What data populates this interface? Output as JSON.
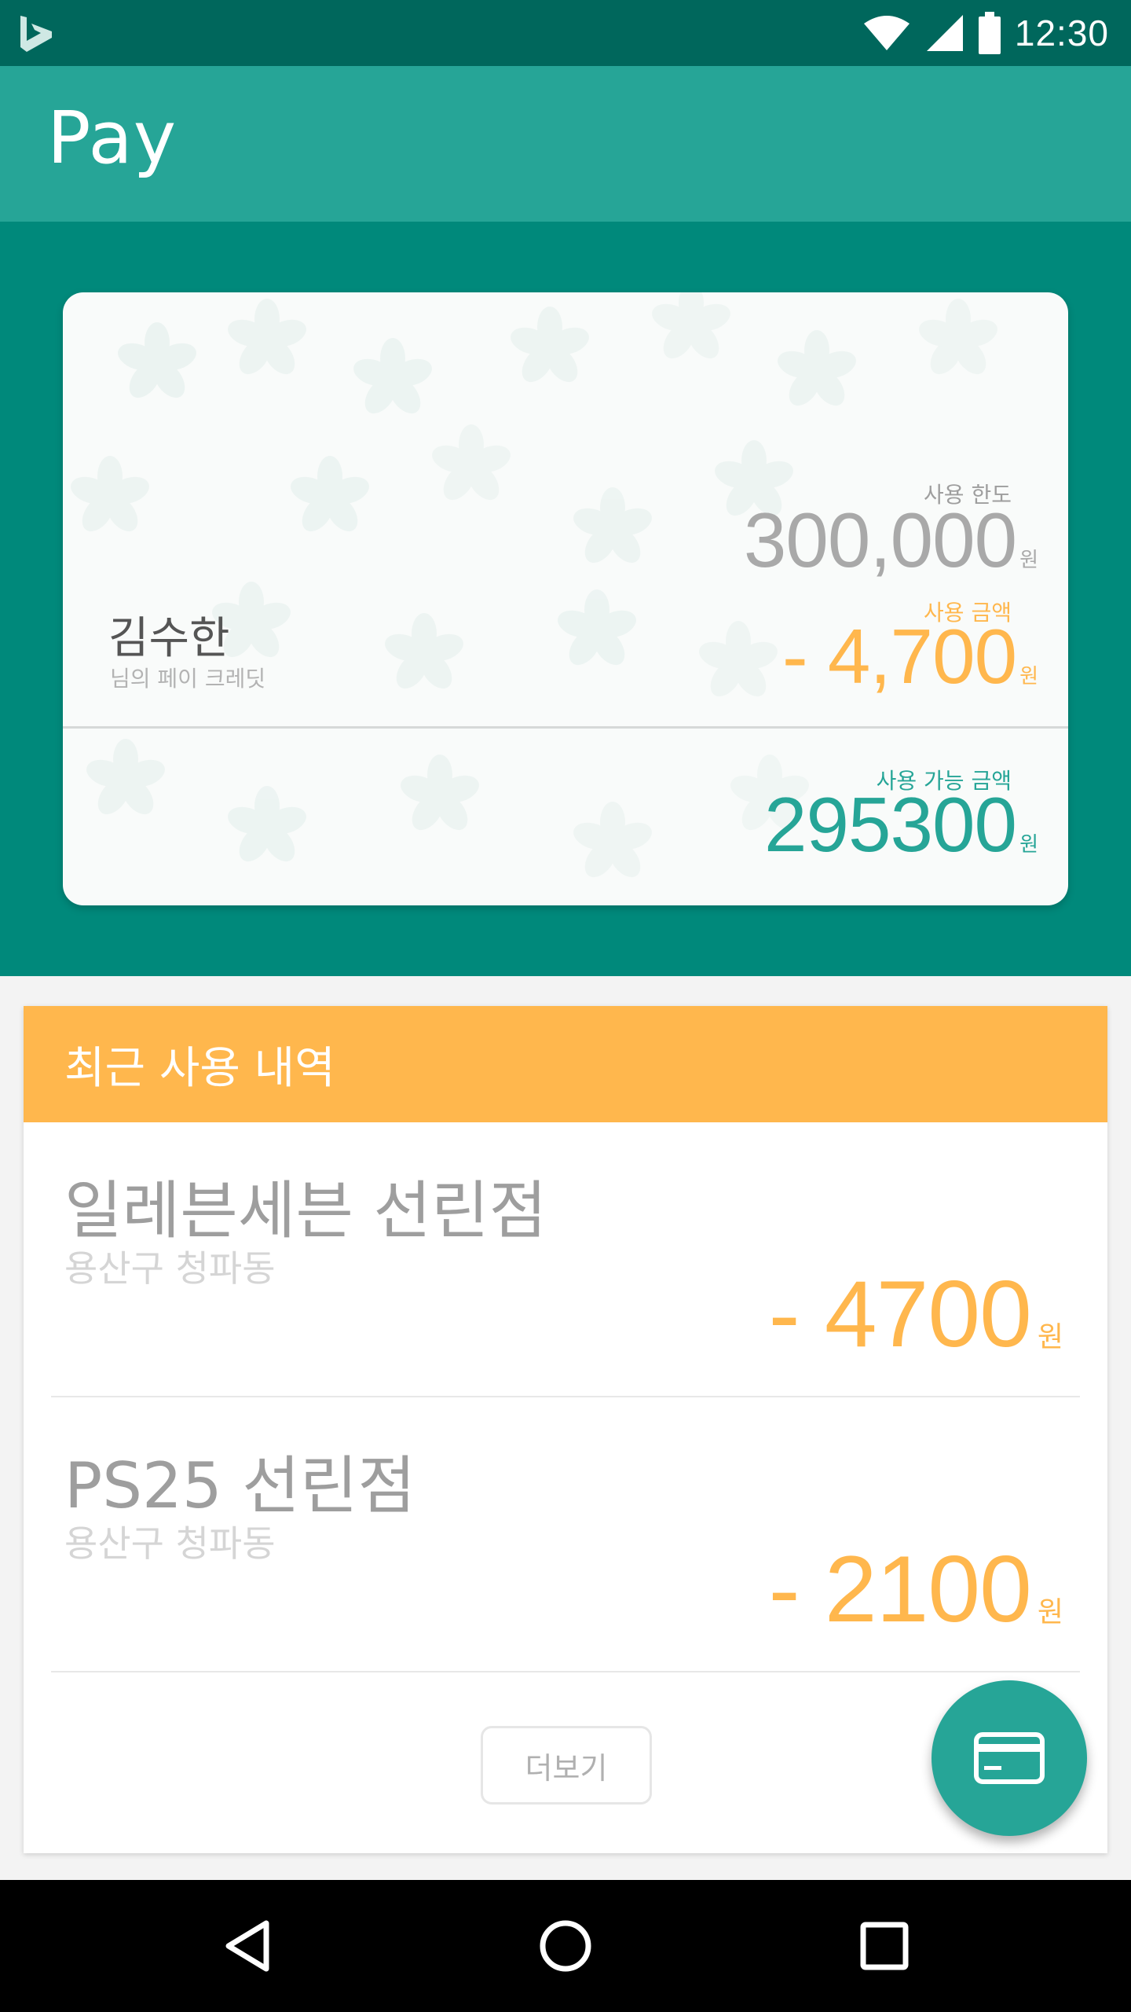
{
  "status_bar": {
    "time": "12:30",
    "icons": [
      "bing-logo-icon",
      "wifi-icon",
      "signal-icon",
      "battery-icon"
    ]
  },
  "app_bar": {
    "title": "Pay"
  },
  "card": {
    "holder_name": "김수한",
    "holder_subtitle": "님의 페이 크레딧",
    "limit_label": "사용 한도",
    "limit_value": "300,000",
    "limit_unit": "원",
    "used_label": "사용 금액",
    "used_value": "- 4,700",
    "used_unit": "원",
    "available_label": "사용 가능 금액",
    "available_value": "295300",
    "available_unit": "원"
  },
  "history": {
    "title": "최근 사용 내역",
    "items": [
      {
        "name": "일레븐세븐 선린점",
        "location": "용산구 청파동",
        "amount": "- 4700",
        "unit": "원"
      },
      {
        "name": "PS25 선린점",
        "location": "용산구 청파동",
        "amount": "- 2100",
        "unit": "원"
      }
    ],
    "more_label": "더보기"
  },
  "fab": {
    "icon": "credit-card-icon"
  },
  "nav_bar": {
    "icons": [
      "back-triangle-icon",
      "home-circle-icon",
      "recents-square-icon"
    ]
  },
  "colors": {
    "status_bar": "#00675c",
    "app_bar": "#26a597",
    "hero": "#00897b",
    "accent_orange": "#ffb74d",
    "accent_teal": "#26a597"
  }
}
